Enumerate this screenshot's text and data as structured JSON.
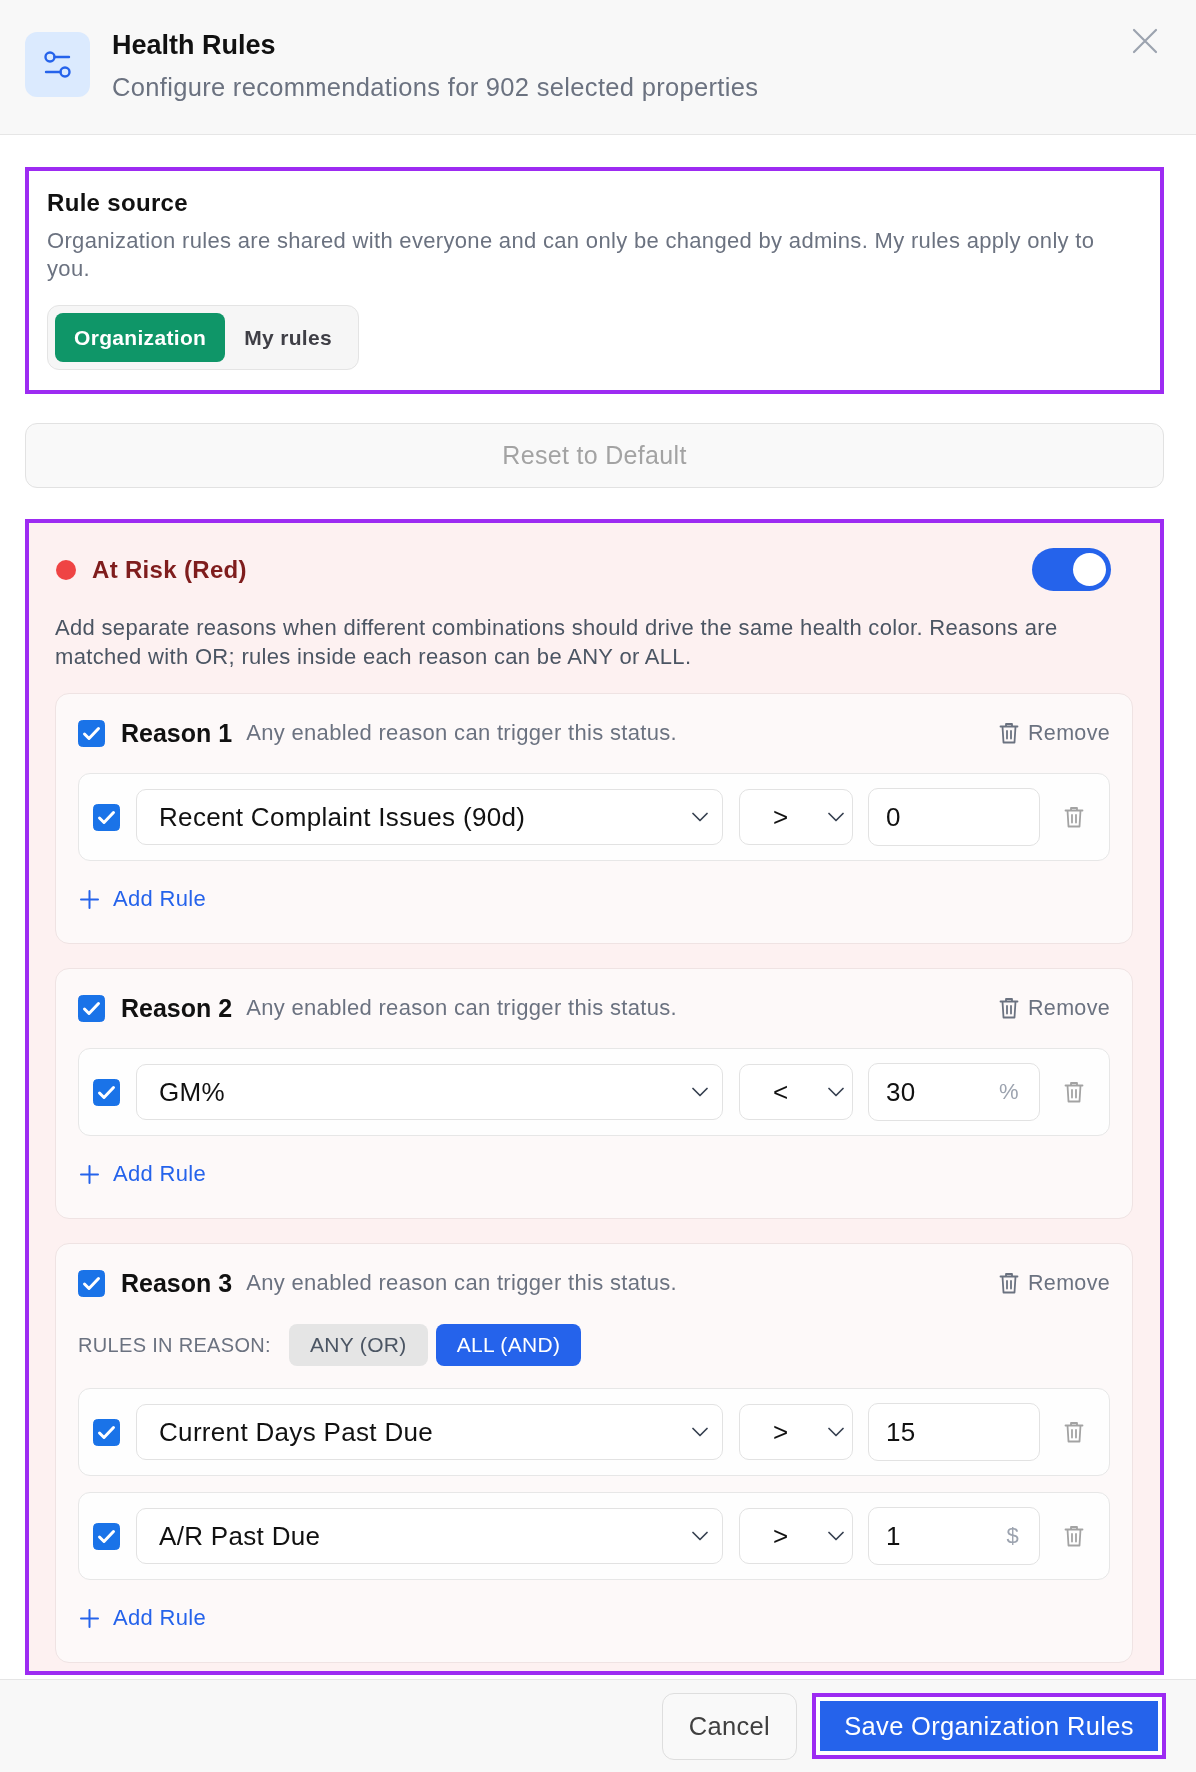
{
  "header": {
    "title": "Health Rules",
    "subtitle": "Configure recommendations for 902 selected properties"
  },
  "rule_source": {
    "highlighted": true,
    "title": "Rule source",
    "description": "Organization rules are shared with everyone and can only be changed by admins. My rules apply only to you.",
    "options": [
      {
        "label": "Organization",
        "selected": true
      },
      {
        "label": "My rules",
        "selected": false
      }
    ]
  },
  "reset_button": {
    "label": "Reset to Default",
    "disabled": true
  },
  "status_sections": [
    {
      "title": "At Risk (Red)",
      "color": "#ef4444",
      "enabled": true,
      "highlighted": true,
      "description": "Add separate reasons when different combinations should drive the same health color. Reasons are matched with OR; rules inside each reason can be ANY or ALL.",
      "reasons": [
        {
          "label": "Reason 1",
          "hint": "Any enabled reason can trigger this status.",
          "checked": true,
          "remove_label": "Remove",
          "rules": [
            {
              "checked": true,
              "metric": "Recent Complaint Issues (90d)",
              "operator": ">",
              "value": "0"
            }
          ],
          "add_rule_label": "Add Rule"
        },
        {
          "label": "Reason 2",
          "hint": "Any enabled reason can trigger this status.",
          "checked": true,
          "remove_label": "Remove",
          "rules": [
            {
              "checked": true,
              "metric": "GM%",
              "operator": "<",
              "value": "30",
              "unit": "%"
            }
          ],
          "add_rule_label": "Add Rule"
        },
        {
          "label": "Reason 3",
          "hint": "Any enabled reason can trigger this status.",
          "checked": true,
          "remove_label": "Remove",
          "mode_label": "RULES IN REASON:",
          "modes": [
            {
              "label": "ANY (OR)",
              "selected": false
            },
            {
              "label": "ALL (AND)",
              "selected": true
            }
          ],
          "rules": [
            {
              "checked": true,
              "metric": "Current Days Past Due",
              "operator": ">",
              "value": "15"
            },
            {
              "checked": true,
              "metric": "A/R Past Due",
              "operator": ">",
              "value": "1",
              "unit": "$"
            }
          ],
          "add_rule_label": "Add Rule"
        }
      ]
    }
  ],
  "footer": {
    "buttons": [
      {
        "label": "Cancel",
        "kind": "secondary",
        "highlighted": false
      },
      {
        "label": "Save Organization Rules",
        "kind": "primary",
        "highlighted": true
      }
    ]
  }
}
